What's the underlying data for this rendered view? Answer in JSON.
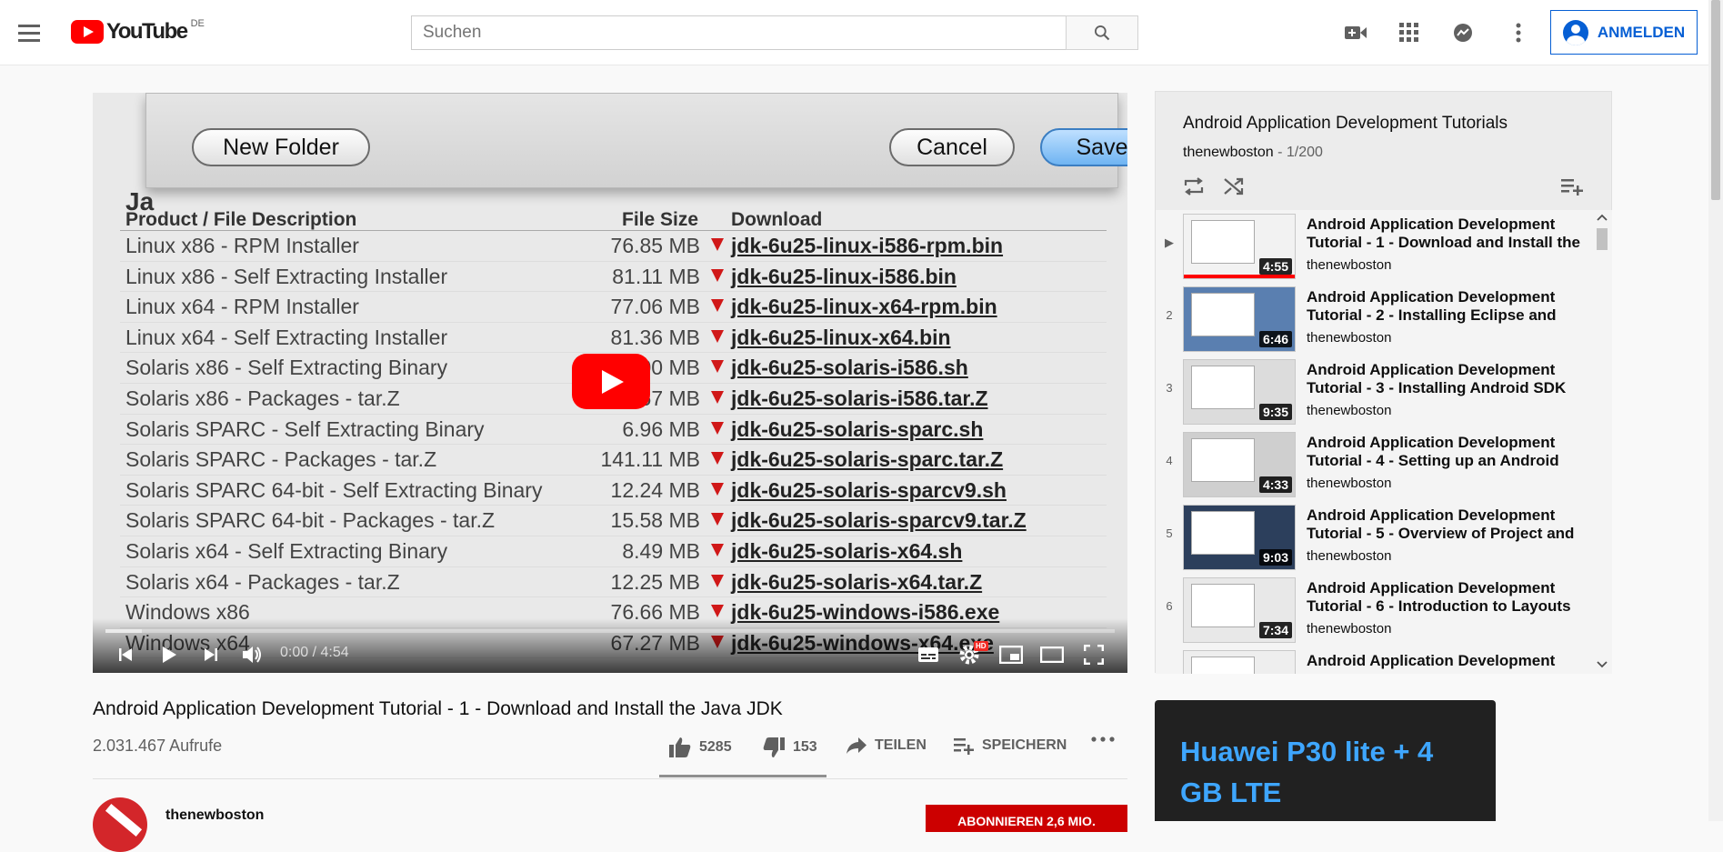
{
  "masthead": {
    "logo_text": "YouTube",
    "country_code": "DE",
    "search_placeholder": "Suchen",
    "signin_label": "ANMELDEN"
  },
  "player": {
    "dialog_buttons": {
      "new_folder": "New Folder",
      "cancel": "Cancel",
      "save": "Save"
    },
    "table_header": {
      "c1": "Product / File Description",
      "c2": "File Size",
      "c3": "Download"
    },
    "table_partial_title": "Ja",
    "rows": [
      {
        "desc": "Linux x86 - RPM Installer",
        "size": "76.85 MB",
        "file": "jdk-6u25-linux-i586-rpm.bin"
      },
      {
        "desc": "Linux x86 - Self Extracting Installer",
        "size": "81.11 MB",
        "file": "jdk-6u25-linux-i586.bin"
      },
      {
        "desc": "Linux x64 - RPM Installer",
        "size": "77.06 MB",
        "file": "jdk-6u25-linux-x64-rpm.bin"
      },
      {
        "desc": "Linux x64 - Self Extracting Installer",
        "size": "81.36 MB",
        "file": "jdk-6u25-linux-x64.bin"
      },
      {
        "desc": "Solaris x86 - Self Extracting Binary",
        "size": "81.00 MB",
        "file": "jdk-6u25-solaris-i586.sh"
      },
      {
        "desc": "Solaris x86 - Packages - tar.Z",
        "size": "6.67 MB",
        "file": "jdk-6u25-solaris-i586.tar.Z"
      },
      {
        "desc": "Solaris SPARC - Self Extracting Binary",
        "size": "6.96 MB",
        "file": "jdk-6u25-solaris-sparc.sh"
      },
      {
        "desc": "Solaris SPARC - Packages - tar.Z",
        "size": "141.11 MB",
        "file": "jdk-6u25-solaris-sparc.tar.Z"
      },
      {
        "desc": "Solaris SPARC 64-bit - Self Extracting Binary",
        "size": "12.24 MB",
        "file": "jdk-6u25-solaris-sparcv9.sh"
      },
      {
        "desc": "Solaris SPARC 64-bit - Packages - tar.Z",
        "size": "15.58 MB",
        "file": "jdk-6u25-solaris-sparcv9.tar.Z"
      },
      {
        "desc": "Solaris x64 - Self Extracting Binary",
        "size": "8.49 MB",
        "file": "jdk-6u25-solaris-x64.sh"
      },
      {
        "desc": "Solaris x64 - Packages - tar.Z",
        "size": "12.25 MB",
        "file": "jdk-6u25-solaris-x64.tar.Z"
      },
      {
        "desc": "Windows x86",
        "size": "76.66 MB",
        "file": "jdk-6u25-windows-i586.exe"
      },
      {
        "desc": "Windows x64",
        "size": "67.27 MB",
        "file": "jdk-6u25-windows-x64.exe"
      }
    ],
    "time_display": "0:00 / 4:54",
    "progress_played_fraction": 0.0,
    "hd_badge": "HD"
  },
  "video": {
    "title": "Android Application Development Tutorial - 1 - Download and Install the Java JDK",
    "views": "2.031.467 Aufrufe",
    "likes": "5285",
    "dislikes": "153",
    "share_label": "TEILEN",
    "save_label": "SPEICHERN",
    "channel_name": "thenewboston",
    "subscribe_label": "ABONNIEREN 2,6 MIO."
  },
  "playlist": {
    "title": "Android Application Development Tutorials",
    "channel": "thenewboston",
    "position": " - 1/200",
    "items": [
      {
        "index": "▶",
        "title": "Android Application Development Tutorial - 1 - Download and Install the",
        "channel": "thenewboston",
        "duration": "4:55"
      },
      {
        "index": "2",
        "title": "Android Application Development Tutorial - 2 - Installing Eclipse and",
        "channel": "thenewboston",
        "duration": "6:46"
      },
      {
        "index": "3",
        "title": "Android Application Development Tutorial - 3 - Installing Android SDK",
        "channel": "thenewboston",
        "duration": "9:35"
      },
      {
        "index": "4",
        "title": "Android Application Development Tutorial - 4 - Setting up an Android",
        "channel": "thenewboston",
        "duration": "4:33"
      },
      {
        "index": "5",
        "title": "Android Application Development Tutorial - 5 - Overview of Project and",
        "channel": "thenewboston",
        "duration": "9:03"
      },
      {
        "index": "6",
        "title": "Android Application Development Tutorial - 6 - Introduction to Layouts",
        "channel": "thenewboston",
        "duration": "7:34"
      },
      {
        "index": "",
        "title": "Android Application Development",
        "channel": "",
        "duration": ""
      }
    ]
  },
  "ad": {
    "text": "Huawei P30 lite + 4 GB LTE"
  },
  "colors": {
    "brand_red": "#ff0000",
    "link_blue": "#065fd4",
    "ad_blue": "#3ea6ff"
  }
}
